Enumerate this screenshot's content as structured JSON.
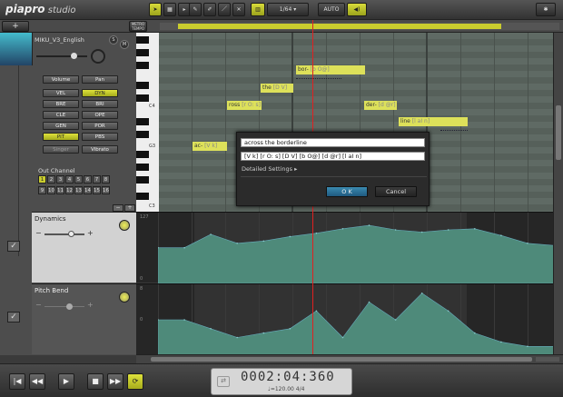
{
  "app": {
    "logo": "piapro",
    "logo_sub": "studio"
  },
  "toolbar": {
    "add_label": "+",
    "metro_label": "METRO TEMPO",
    "quantize": "1/64",
    "auto_label": "AUTO"
  },
  "track": {
    "name": "MIKU_V3_English",
    "s_label": "S",
    "m_label": "M"
  },
  "params": {
    "volume": "Volume",
    "pan": "Pan",
    "buttons": [
      "VEL",
      "DYN",
      "BRE",
      "BRI",
      "CLE",
      "OPE",
      "GEN",
      "POR",
      "PIT",
      "PBS"
    ],
    "active": [
      "DYN",
      "PIT"
    ],
    "singer": "Singer",
    "vibrato": "Vibrato"
  },
  "out_channel": {
    "label": "Out Channel",
    "channels": [
      "1",
      "2",
      "3",
      "4",
      "5",
      "6",
      "7",
      "8",
      "9",
      "10",
      "11",
      "12",
      "13",
      "14",
      "15",
      "16"
    ],
    "selected": "1"
  },
  "piano": {
    "c4": "C4",
    "g3": "G3",
    "c3": "C3"
  },
  "notes": [
    {
      "word": "bor-",
      "ph": "[b O@]"
    },
    {
      "word": "the",
      "ph": "[D V]"
    },
    {
      "word": "ross",
      "ph": "[r O: s]"
    },
    {
      "word": "der-",
      "ph": "[d @r]"
    },
    {
      "word": "line",
      "ph": "[l aI n]"
    },
    {
      "word": "ac-",
      "ph": "[V k]"
    }
  ],
  "dialog": {
    "lyrics": "across the borderline",
    "phonemes": "[V k] [r O: s] [D V] [b O@] [d @r] [l aI n]",
    "detailed": "Detailed Settings",
    "ok": "O K",
    "cancel": "Cancel"
  },
  "dynamics": {
    "label": "Dynamics",
    "top_tick": "127",
    "mid_tick": "0",
    "minus": "−",
    "plus": "+"
  },
  "pitchbend": {
    "label": "Pitch Bend",
    "tick": "8",
    "mid_tick": "0",
    "minus": "−",
    "plus": "+"
  },
  "transport": {
    "time": "0002:04:360",
    "tempo": "♩=120.00",
    "timesig": "4/4"
  },
  "colors": {
    "accent": "#d8dc3a",
    "roll_bg": "#5f6a64",
    "curve": "#4e8a7a",
    "playhead": "#e02020"
  },
  "chart_data": {
    "type": "area",
    "series": [
      {
        "name": "Dynamics",
        "values": [
          64,
          64,
          88,
          72,
          76,
          84,
          90,
          98,
          104,
          96,
          92,
          96,
          98,
          86,
          72,
          68
        ]
      },
      {
        "name": "Pitch Bend",
        "values": [
          0,
          0,
          -2,
          -4,
          -3,
          -2,
          2,
          -4,
          4,
          0,
          6,
          2,
          -3,
          -5,
          -6,
          -6
        ]
      }
    ],
    "ylim_dynamics": [
      0,
      127
    ],
    "ylim_pitchbend": [
      -8,
      8
    ]
  }
}
